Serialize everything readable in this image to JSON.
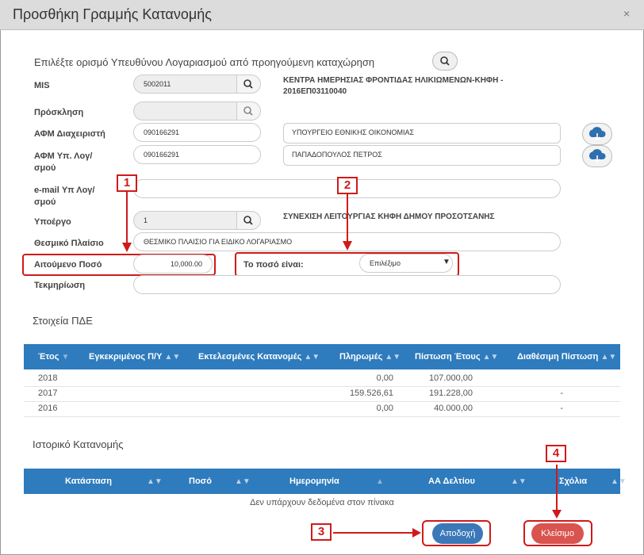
{
  "dialog": {
    "title": "Προσθήκη Γραμμής Κατανομής",
    "close_glyph": "×"
  },
  "form": {
    "select_previous_label": "Επιλέξτε ορισμό Υπευθύνου Λογαριασμού από προηγούμενη καταχώρηση",
    "mis": {
      "label": "MIS",
      "value": "5002011",
      "desc_line1": "ΚΕΝΤΡΑ ΗΜΕΡΗΣΙΑΣ ΦΡΟΝΤΙΔΑΣ ΗΛΙΚΙΩΜΕΝΩΝ-ΚΗΦΗ -",
      "desc_line2": "2016ΕΠ03110040"
    },
    "proskliisi": {
      "label": "Πρόσκληση",
      "value": ""
    },
    "afm_diax": {
      "label": "ΑΦΜ Διαχειριστή",
      "value": "090166291",
      "desc": "ΥΠΟΥΡΓΕΙΟ ΕΘΝΙΚΗΣ ΟΙΚΟΝΟΜΙΑΣ"
    },
    "afm_yp": {
      "label_line1": "ΑΦΜ Υπ. Λογ/",
      "label_line2": "σμού",
      "value": "090166291",
      "desc": "ΠΑΠΑΔΟΠΟΥΛΟΣ ΠΕΤΡΟΣ"
    },
    "email": {
      "label_line1": "e-mail Υπ Λογ/",
      "label_line2": "σμού",
      "value": ""
    },
    "ypoergo": {
      "label": "Υποέργο",
      "value": "1",
      "desc": "ΣΥΝΕΧΙΣΗ ΛΕΙΤΟΥΡΓΙΑΣ ΚΗΦΗ ΔΗΜΟΥ ΠΡΟΣΟΤΣΑΝΗΣ"
    },
    "thesmiko": {
      "label": "Θεσμικό Πλαίσιο",
      "value": "ΘΕΣΜΙΚΟ ΠΛΑΙΣΙΟ ΓΙΑ ΕΙΔΙΚΟ ΛΟΓΑΡΙΑΣΜΟ"
    },
    "amount": {
      "label": "Αιτούμενο Ποσό",
      "value": "10,000.00"
    },
    "amount_type": {
      "label": "Το ποσό είναι:",
      "selected": "Επιλέξιμο"
    },
    "tekmiriosi": {
      "label": "Τεκμηρίωση",
      "value": ""
    }
  },
  "pde": {
    "title": "Στοιχεία ΠΔΕ",
    "columns": [
      "Έτος",
      "Εγκεκριμένος Π/Υ",
      "Εκτελεσμένες Κατανομές",
      "Πληρωμές",
      "Πίστωση Έτους",
      "Διαθέσιμη Πίστωση"
    ],
    "rows": [
      {
        "year": "2018",
        "approved": "",
        "executed": "",
        "payments": "0,00",
        "credit": "107.000,00",
        "available": ""
      },
      {
        "year": "2017",
        "approved": "",
        "executed": "",
        "payments": "159.526,61",
        "credit": "191.228,00",
        "available": "-"
      },
      {
        "year": "2016",
        "approved": "",
        "executed": "",
        "payments": "0,00",
        "credit": "40.000,00",
        "available": "-"
      }
    ]
  },
  "history": {
    "title": "Ιστορικό Κατανομής",
    "columns": [
      "Κατάσταση",
      "Ποσό",
      "Ημερομηνία",
      "ΑΑ Δελτίου",
      "Σχόλια"
    ],
    "empty": "Δεν υπάρχουν δεδομένα στον πίνακα"
  },
  "buttons": {
    "accept": "Αποδοχή",
    "close": "Κλείσιμο"
  },
  "annotations": [
    "1",
    "2",
    "3",
    "4"
  ],
  "colors": {
    "header_blue": "#2e7bbd",
    "accept_blue": "#3a78b8",
    "close_red": "#d9534f",
    "annotation_red": "#d01a1a"
  }
}
